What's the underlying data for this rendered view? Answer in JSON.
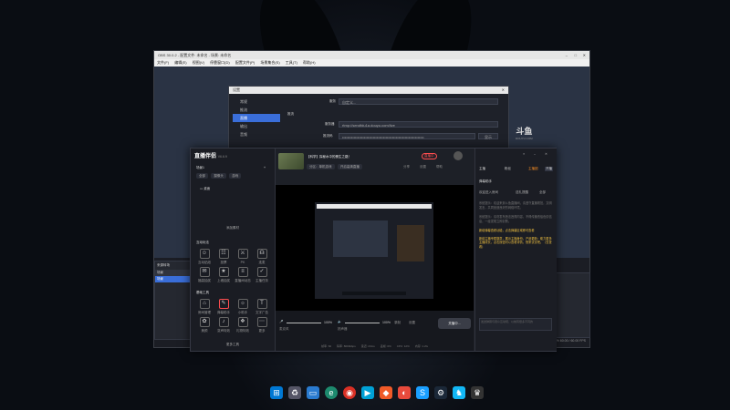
{
  "watermark": {
    "logo": "斗鱼",
    "sub": "DOUYU.COM"
  },
  "obs": {
    "title": "OBS 30.0.2 - 配置文件: 未命名 - 场景: 未命名",
    "menu": [
      "文件(F)",
      "编辑(E)",
      "视图(V)",
      "停靠窗口(D)",
      "配置文件(P)",
      "场景集合(S)",
      "工具(T)",
      "帮助(H)"
    ],
    "scenes_label": "来源转场",
    "scenes": [
      "场景",
      "场景"
    ],
    "status": "0:00:00  CPU: 0.3%  60.00 / 60.00 FPS"
  },
  "settings": {
    "title": "设置",
    "nav": [
      "常规",
      "推流",
      "直播",
      "输出",
      "音频"
    ],
    "active_index": 2,
    "service_label": "服务",
    "service_value": "自定义...",
    "section": "推流",
    "server_label": "服务器",
    "server_value": "rtmp://sendfdu1a.douyu.com/live",
    "key_label": "推流码",
    "key_value": "••••••••••••••••••••••••••••••••••••••••••••••••••••••••••••••••",
    "show_label": "显示"
  },
  "companion": {
    "logo": "直播伴侣",
    "version": "V6.6.9",
    "scene_header": "场景1",
    "add_label": "+",
    "tabs": [
      "全部",
      "摄像头",
      "游戏"
    ],
    "source_item": "桌面",
    "add_material": "添加素材",
    "interaction_title": "互动玩法",
    "interaction_tools": [
      "互动贴纸",
      "投票",
      "PK",
      "连麦",
      "福袋抽奖",
      "上墙抽奖",
      "直播间动态",
      "主播任务"
    ],
    "basic_title": "基础工具",
    "basic_tools": [
      "房间管理",
      "弹幕助手",
      "小助手",
      "文字广告",
      "美颜",
      "变声特效",
      "礼物特效",
      "更多"
    ],
    "more_label": "更多工具",
    "stream_title": "【科学】探秘水中的蛋生之路！",
    "stream_tag1": "分区：单机游戏",
    "stream_tag2": "开启高清直播",
    "badge_label": "开播时长",
    "badge_value": "直播中",
    "top_icons": [
      "分享",
      "设置",
      "帮助"
    ],
    "btn_record": "录制",
    "btn_setting": "设置",
    "mic_label": "麦克风",
    "mic_value": "100%",
    "spk_label": "扬声器",
    "spk_value": "100%",
    "btn_stop": "关播中...",
    "bottom_bar": [
      "帧率: 60",
      "码率: 8000kbps",
      "延迟: 23ms",
      "丢帧: 0%",
      "CPU: 12%",
      "内存: 1.2G"
    ],
    "right_tabs": [
      "主播",
      "粉丝",
      "主播团"
    ],
    "right_active": "开播",
    "chat_header": "弹幕助手",
    "chat_sub_tabs": [
      "欢迎进入房间",
      "送礼提醒",
      "全部"
    ],
    "chat_lines": [
      "系统提示：欢迎来到斗鱼直播间，请遵守直播规范，文明发言，共同营造良好的网络环境。",
      "系统提示：请勿发布违法违规内容，不得传播低俗色情信息，一经发现立即封禁。",
      "新增弹幕查看功能，点击弹幕区域即可查看",
      "新增主播专属徽章，展示主播身份，产品更新：助力更多主播成长，点击按钮可以查看详情，快来试试吧。（去查看）"
    ],
    "chat_input_placeholder": "发送弹幕与观众互动吧，以前有很多不同的"
  },
  "taskbar": {
    "icons": [
      "start-icon",
      "recycle-icon",
      "desktop-icon",
      "edge-icon",
      "chrome-icon",
      "bilibili-icon",
      "app-icon",
      "sogou-icon",
      "steam-icon",
      "qq-icon",
      "game-icon"
    ]
  },
  "colors": {
    "accent": "#3a6ed9",
    "live_red": "#ff4d4f",
    "orange": "#f08a24"
  }
}
